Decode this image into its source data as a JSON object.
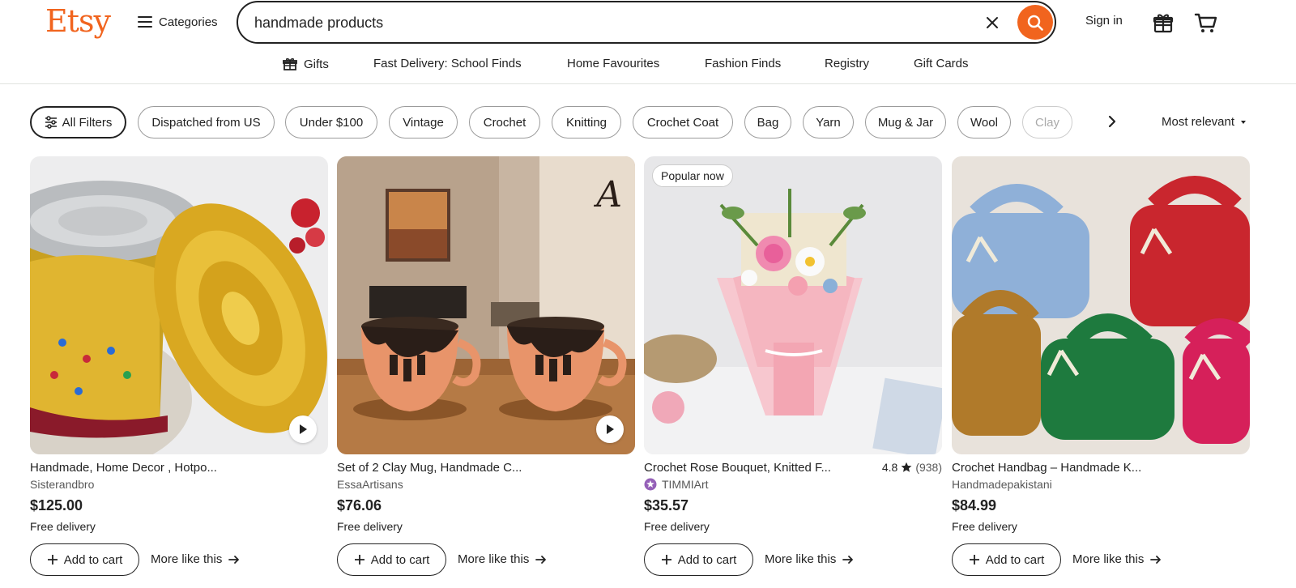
{
  "header": {
    "logo": "Etsy",
    "categories_label": "Categories",
    "search_value": "handmade products",
    "signin_label": "Sign in",
    "accent_color": "#f1641e"
  },
  "subnav": {
    "items": [
      "Gifts",
      "Fast Delivery: School Finds",
      "Home Favourites",
      "Fashion Finds",
      "Registry",
      "Gift Cards"
    ]
  },
  "filters": {
    "all_filters_label": "All Filters",
    "chips": [
      "Dispatched from US",
      "Under $100",
      "Vintage",
      "Crochet",
      "Knitting",
      "Crochet Coat",
      "Bag",
      "Yarn",
      "Mug & Jar",
      "Wool",
      "Clay"
    ],
    "sort_label": "Most relevant"
  },
  "products": [
    {
      "title": "Handmade, Home Decor , Hotpo...",
      "shop": "Sisterandbro",
      "price": "$125.00",
      "delivery": "Free delivery",
      "has_video": true,
      "image": "golden-woven-basket"
    },
    {
      "title": "Set of 2 Clay Mug, Handmade C...",
      "shop": "EssaArtisans",
      "price": "$76.06",
      "delivery": "Free delivery",
      "has_video": true,
      "image": "clay-mugs",
      "watermark": "A"
    },
    {
      "title": "Crochet Rose Bouquet, Knitted F...",
      "shop": "TIMMIArt",
      "price": "$35.57",
      "delivery": "Free delivery",
      "badge": "Popular now",
      "rating": "4.8",
      "review_count": "(938)",
      "star_seller": true,
      "image": "crochet-bouquet"
    },
    {
      "title": "Crochet Handbag – Handmade K...",
      "shop": "Handmadepakistani",
      "price": "$84.99",
      "delivery": "Free delivery",
      "image": "knitted-handbags"
    }
  ],
  "actions": {
    "add_to_cart": "Add to cart",
    "more_like_this": "More like this"
  }
}
